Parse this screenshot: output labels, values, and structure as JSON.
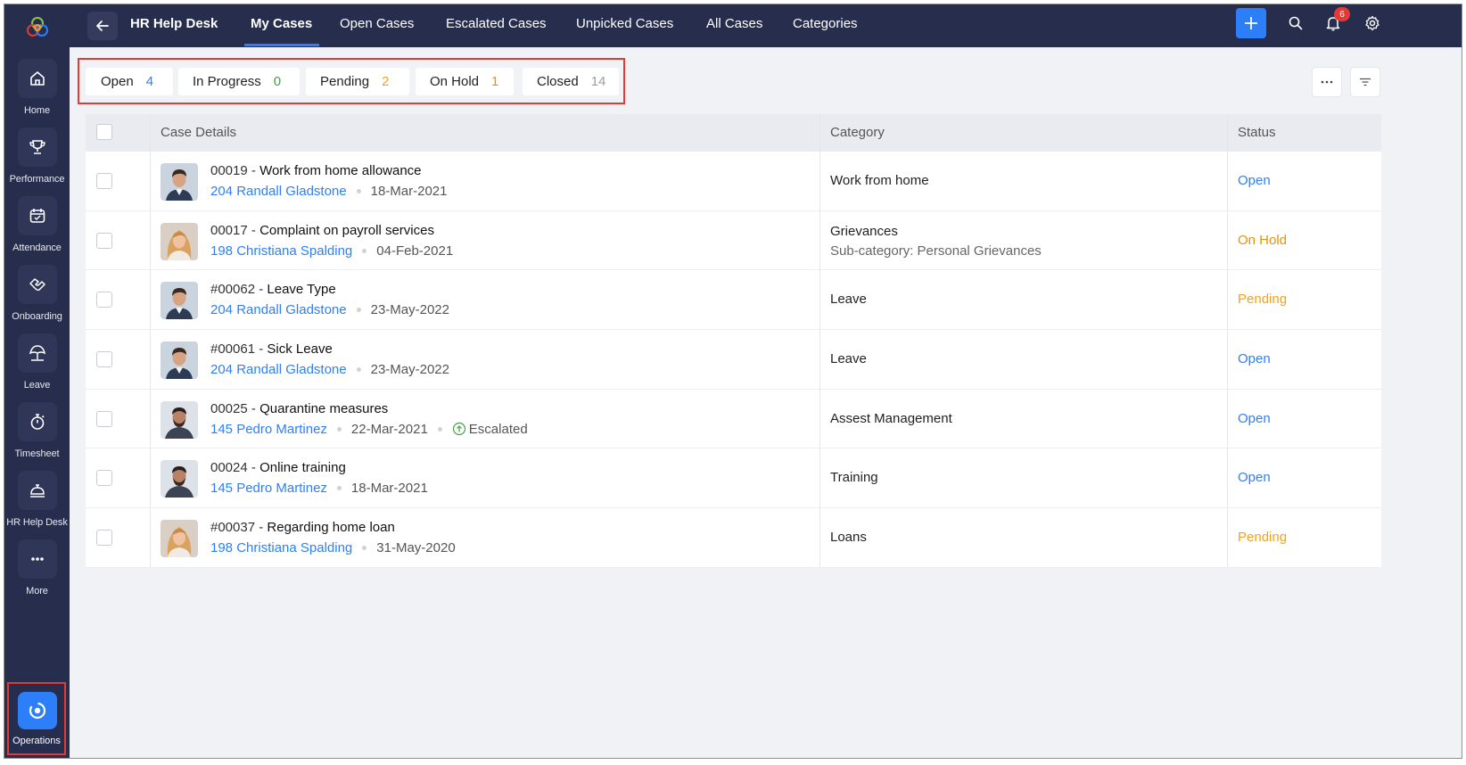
{
  "colors": {
    "accent": "#2d7ff9",
    "open": "#2d7ff9",
    "in_progress": "#43a047",
    "pending": "#f4a21c",
    "on_hold": "#e6920a",
    "closed": "#9aa0a6",
    "sidebar_bg": "#262d4d",
    "highlight": "#e53935"
  },
  "sidebar": {
    "items": [
      {
        "label": "Home",
        "icon": "home-icon"
      },
      {
        "label": "Performance",
        "icon": "trophy-icon"
      },
      {
        "label": "Attendance",
        "icon": "calendar-icon"
      },
      {
        "label": "Onboarding",
        "icon": "handshake-icon"
      },
      {
        "label": "Leave",
        "icon": "umbrella-icon"
      },
      {
        "label": "Timesheet",
        "icon": "stopwatch-icon"
      },
      {
        "label": "HR Help Desk",
        "icon": "desk-bell-icon"
      },
      {
        "label": "More",
        "icon": "more-icon"
      }
    ],
    "operations_label": "Operations"
  },
  "header": {
    "title": "HR Help Desk",
    "tabs": [
      "My Cases",
      "Open Cases",
      "Escalated Cases",
      "Unpicked Cases",
      "All Cases",
      "Categories"
    ],
    "notification_count": "6"
  },
  "filters": [
    {
      "label": "Open",
      "count": "4",
      "color": "#2d7ff9"
    },
    {
      "label": "In Progress",
      "count": "0",
      "color": "#43a047"
    },
    {
      "label": "Pending",
      "count": "2",
      "color": "#f4a21c"
    },
    {
      "label": "On Hold",
      "count": "1",
      "color": "#e6920a"
    },
    {
      "label": "Closed",
      "count": "14",
      "color": "#9aa0a6"
    }
  ],
  "table": {
    "columns": [
      "Case Details",
      "Category",
      "Status"
    ],
    "rows": [
      {
        "id": "00019",
        "title": "Work from home allowance",
        "employee": "204 Randall Gladstone",
        "date": "18-Mar-2021",
        "escalated": "",
        "category": "Work from home",
        "subcategory": "",
        "status": "Open",
        "avatar": "man-short-hair"
      },
      {
        "id": "00017",
        "title": "Complaint on payroll services",
        "employee": "198 Christiana Spalding",
        "date": "04-Feb-2021",
        "escalated": "",
        "category": "Grievances",
        "subcategory": "Sub-category: Personal Grievances",
        "status": "On Hold",
        "avatar": "woman-blonde"
      },
      {
        "id": "#00062",
        "title": "Leave Type",
        "employee": "204 Randall Gladstone",
        "date": "23-May-2022",
        "escalated": "",
        "category": "Leave",
        "subcategory": "",
        "status": "Pending",
        "avatar": "man-short-hair"
      },
      {
        "id": "#00061",
        "title": "Sick Leave",
        "employee": "204 Randall Gladstone",
        "date": "23-May-2022",
        "escalated": "",
        "category": "Leave",
        "subcategory": "",
        "status": "Open",
        "avatar": "man-short-hair"
      },
      {
        "id": "00025",
        "title": "Quarantine measures",
        "employee": "145 Pedro Martinez",
        "date": "22-Mar-2021",
        "escalated": "Escalated",
        "category": "Assest Management",
        "subcategory": "",
        "status": "Open",
        "avatar": "man-beard"
      },
      {
        "id": "00024",
        "title": "Online training",
        "employee": "145 Pedro Martinez",
        "date": "18-Mar-2021",
        "escalated": "",
        "category": "Training",
        "subcategory": "",
        "status": "Open",
        "avatar": "man-beard"
      },
      {
        "id": "#00037",
        "title": "Regarding home loan",
        "employee": "198 Christiana Spalding",
        "date": "31-May-2020",
        "escalated": "",
        "category": "Loans",
        "subcategory": "",
        "status": "Pending",
        "avatar": "woman-blonde"
      }
    ]
  }
}
